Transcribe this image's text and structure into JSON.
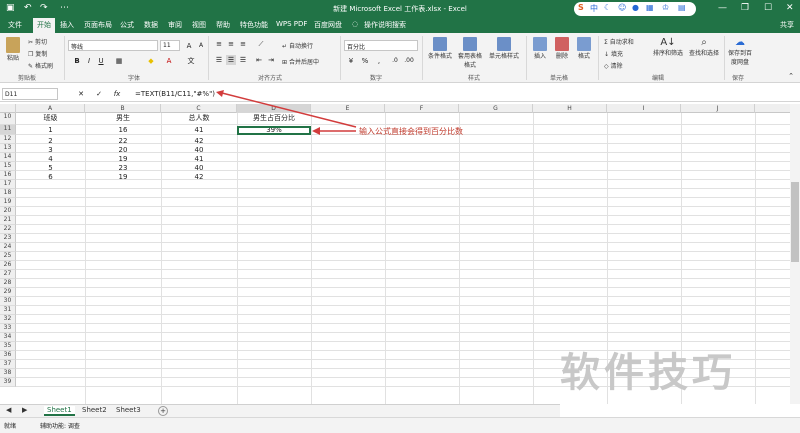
{
  "window": {
    "title": "新建 Microsoft Excel 工作表.xlsx - Excel"
  },
  "ime": {
    "logo": "S",
    "mode": "中"
  },
  "tabs": [
    "文件",
    "开始",
    "插入",
    "页面布局",
    "公式",
    "数据",
    "审阅",
    "视图",
    "帮助",
    "特色功能",
    "WPS PDF",
    "百度网盘",
    "操作说明搜索"
  ],
  "share": "共享",
  "ribbon": {
    "clipboard": {
      "paste": "粘贴",
      "cut": "剪切",
      "copy": "复制",
      "format_painter": "格式刷",
      "label": "剪贴板"
    },
    "font": {
      "name": "等线",
      "size": "11",
      "label": "字体"
    },
    "align": {
      "wrap": "自动换行",
      "merge": "合并后居中",
      "label": "对齐方式"
    },
    "number": {
      "format": "百分比",
      "label": "数字"
    },
    "styles": {
      "conditional": "条件格式",
      "table": "套用表格格式",
      "cell_styles": "单元格样式",
      "label": "样式"
    },
    "cells": {
      "insert": "插入",
      "delete": "删除",
      "format": "格式",
      "label": "单元格"
    },
    "editing": {
      "autosum": "自动求和",
      "fill": "填充",
      "clear": "清除",
      "sort": "排序和筛选",
      "find": "查找和选择",
      "label": "编辑"
    },
    "save": {
      "save_to": "保存到百度网盘",
      "label": "保存"
    }
  },
  "formula_bar": {
    "name_box": "D11",
    "formula": "=TEXT(B11/C11,\"#%\")"
  },
  "columns": [
    "A",
    "B",
    "C",
    "D",
    "E",
    "F",
    "G",
    "H",
    "I",
    "J"
  ],
  "rows": [
    "10",
    "11",
    "12",
    "13",
    "14",
    "15",
    "16",
    "17",
    "18",
    "19",
    "20",
    "21",
    "22",
    "23",
    "24",
    "25",
    "26",
    "27",
    "28",
    "29",
    "30",
    "31",
    "32",
    "33",
    "34",
    "35",
    "36",
    "37",
    "38",
    "39"
  ],
  "headers": {
    "A": "班级",
    "B": "男生",
    "C": "总人数",
    "D": "男生占百分比"
  },
  "table": [
    [
      "1",
      "16",
      "41",
      "39%"
    ],
    [
      "2",
      "22",
      "42",
      ""
    ],
    [
      "3",
      "20",
      "40",
      ""
    ],
    [
      "4",
      "19",
      "41",
      ""
    ],
    [
      "5",
      "23",
      "40",
      ""
    ],
    [
      "6",
      "19",
      "42",
      ""
    ]
  ],
  "annotation": "输入公式直接会得到百分比数",
  "sheets": [
    "Sheet1",
    "Sheet2",
    "Sheet3"
  ],
  "status": {
    "ready": "就绪",
    "accessibility": "辅助功能: 调查"
  },
  "watermark": "软件技巧"
}
